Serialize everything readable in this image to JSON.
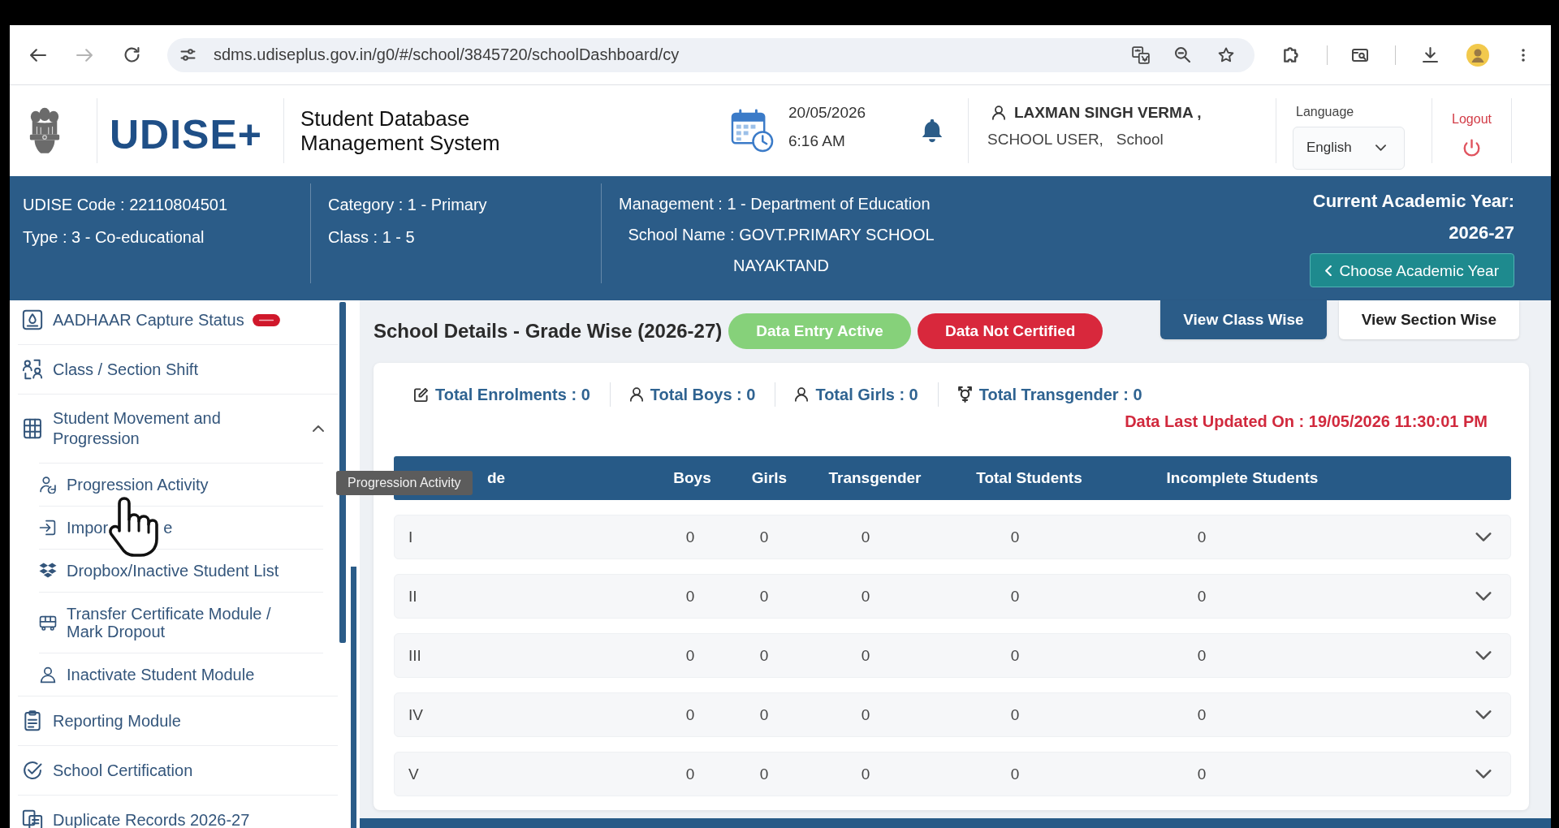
{
  "browser": {
    "url": "sdms.udiseplus.gov.in/g0/#/school/3845720/schoolDashboard/cy"
  },
  "header": {
    "logo": "UDISE+",
    "system_name": "Student Database Management System",
    "date": "20/05/2026",
    "time": "6:16 AM",
    "user_name": "LAXMAN SINGH VERMA ,",
    "user_role": "SCHOOL USER,   School",
    "language_label": "Language",
    "language": "English",
    "logout": "Logout"
  },
  "school_info": {
    "udise_code": "UDISE Code : 22110804501",
    "type": "Type : 3 - Co-educational",
    "category": "Category : 1 - Primary",
    "class": "Class : 1 - 5",
    "management": "Management : 1 - Department of Education",
    "school_name": "School Name : GOVT.PRIMARY SCHOOL NAYAKTAND",
    "academic_year_label": "Current Academic Year:",
    "academic_year": "2026-27",
    "choose_year_button": "Choose Academic Year"
  },
  "sidebar": {
    "items": [
      {
        "label": "AADHAAR Capture Status",
        "new_badge": true
      },
      {
        "label": "Class / Section Shift",
        "new_badge": false
      },
      {
        "label": "Student Movement and Progression",
        "new_badge": false,
        "expanded": true,
        "children": [
          {
            "label": "Progression Activity"
          },
          {
            "label": "Impor",
            "label_after_cursor": "e"
          },
          {
            "label": "Dropbox/Inactive Student List"
          },
          {
            "label": "Transfer Certificate Module / Mark Dropout"
          },
          {
            "label": "Inactivate Student Module"
          }
        ]
      },
      {
        "label": "Reporting Module",
        "new_badge": false
      },
      {
        "label": "School Certification",
        "new_badge": false
      },
      {
        "label": "Duplicate Records 2026-27",
        "new_badge": false
      }
    ]
  },
  "tooltip": {
    "text": "Progression Activity"
  },
  "main": {
    "title": "School Details - Grade Wise (2026-27)",
    "status_badges": [
      {
        "label": "Data Entry Active",
        "color": "#86d17a"
      },
      {
        "label": "Data Not Certified",
        "color": "#d8283c"
      }
    ],
    "view_toggle": [
      {
        "label": "View Class Wise",
        "selected": true
      },
      {
        "label": "View Section Wise",
        "selected": false
      }
    ],
    "totals": [
      {
        "kind": "enrolments",
        "label": "Total Enrolments : 0"
      },
      {
        "kind": "boys",
        "label": "Total Boys : 0"
      },
      {
        "kind": "girls",
        "label": "Total Girls : 0"
      },
      {
        "kind": "transgender",
        "label": "Total Transgender : 0"
      }
    ],
    "last_updated": "Data Last Updated On : 19/05/2026 11:30:01 PM",
    "table": {
      "columns": [
        "de",
        "Boys",
        "Girls",
        "Transgender",
        "Total Students",
        "Incomplete Students"
      ],
      "rows": [
        {
          "cells": [
            "I",
            "0",
            "0",
            "0",
            "0",
            "0"
          ],
          "expanded": false
        },
        {
          "cells": [
            "II",
            "0",
            "0",
            "0",
            "0",
            "0"
          ],
          "expanded": false
        },
        {
          "cells": [
            "III",
            "0",
            "0",
            "0",
            "0",
            "0"
          ],
          "expanded": false
        },
        {
          "cells": [
            "IV",
            "0",
            "0",
            "0",
            "0",
            "0"
          ],
          "expanded": false
        },
        {
          "cells": [
            "V",
            "0",
            "0",
            "0",
            "0",
            "0"
          ],
          "expanded": false
        }
      ]
    }
  }
}
